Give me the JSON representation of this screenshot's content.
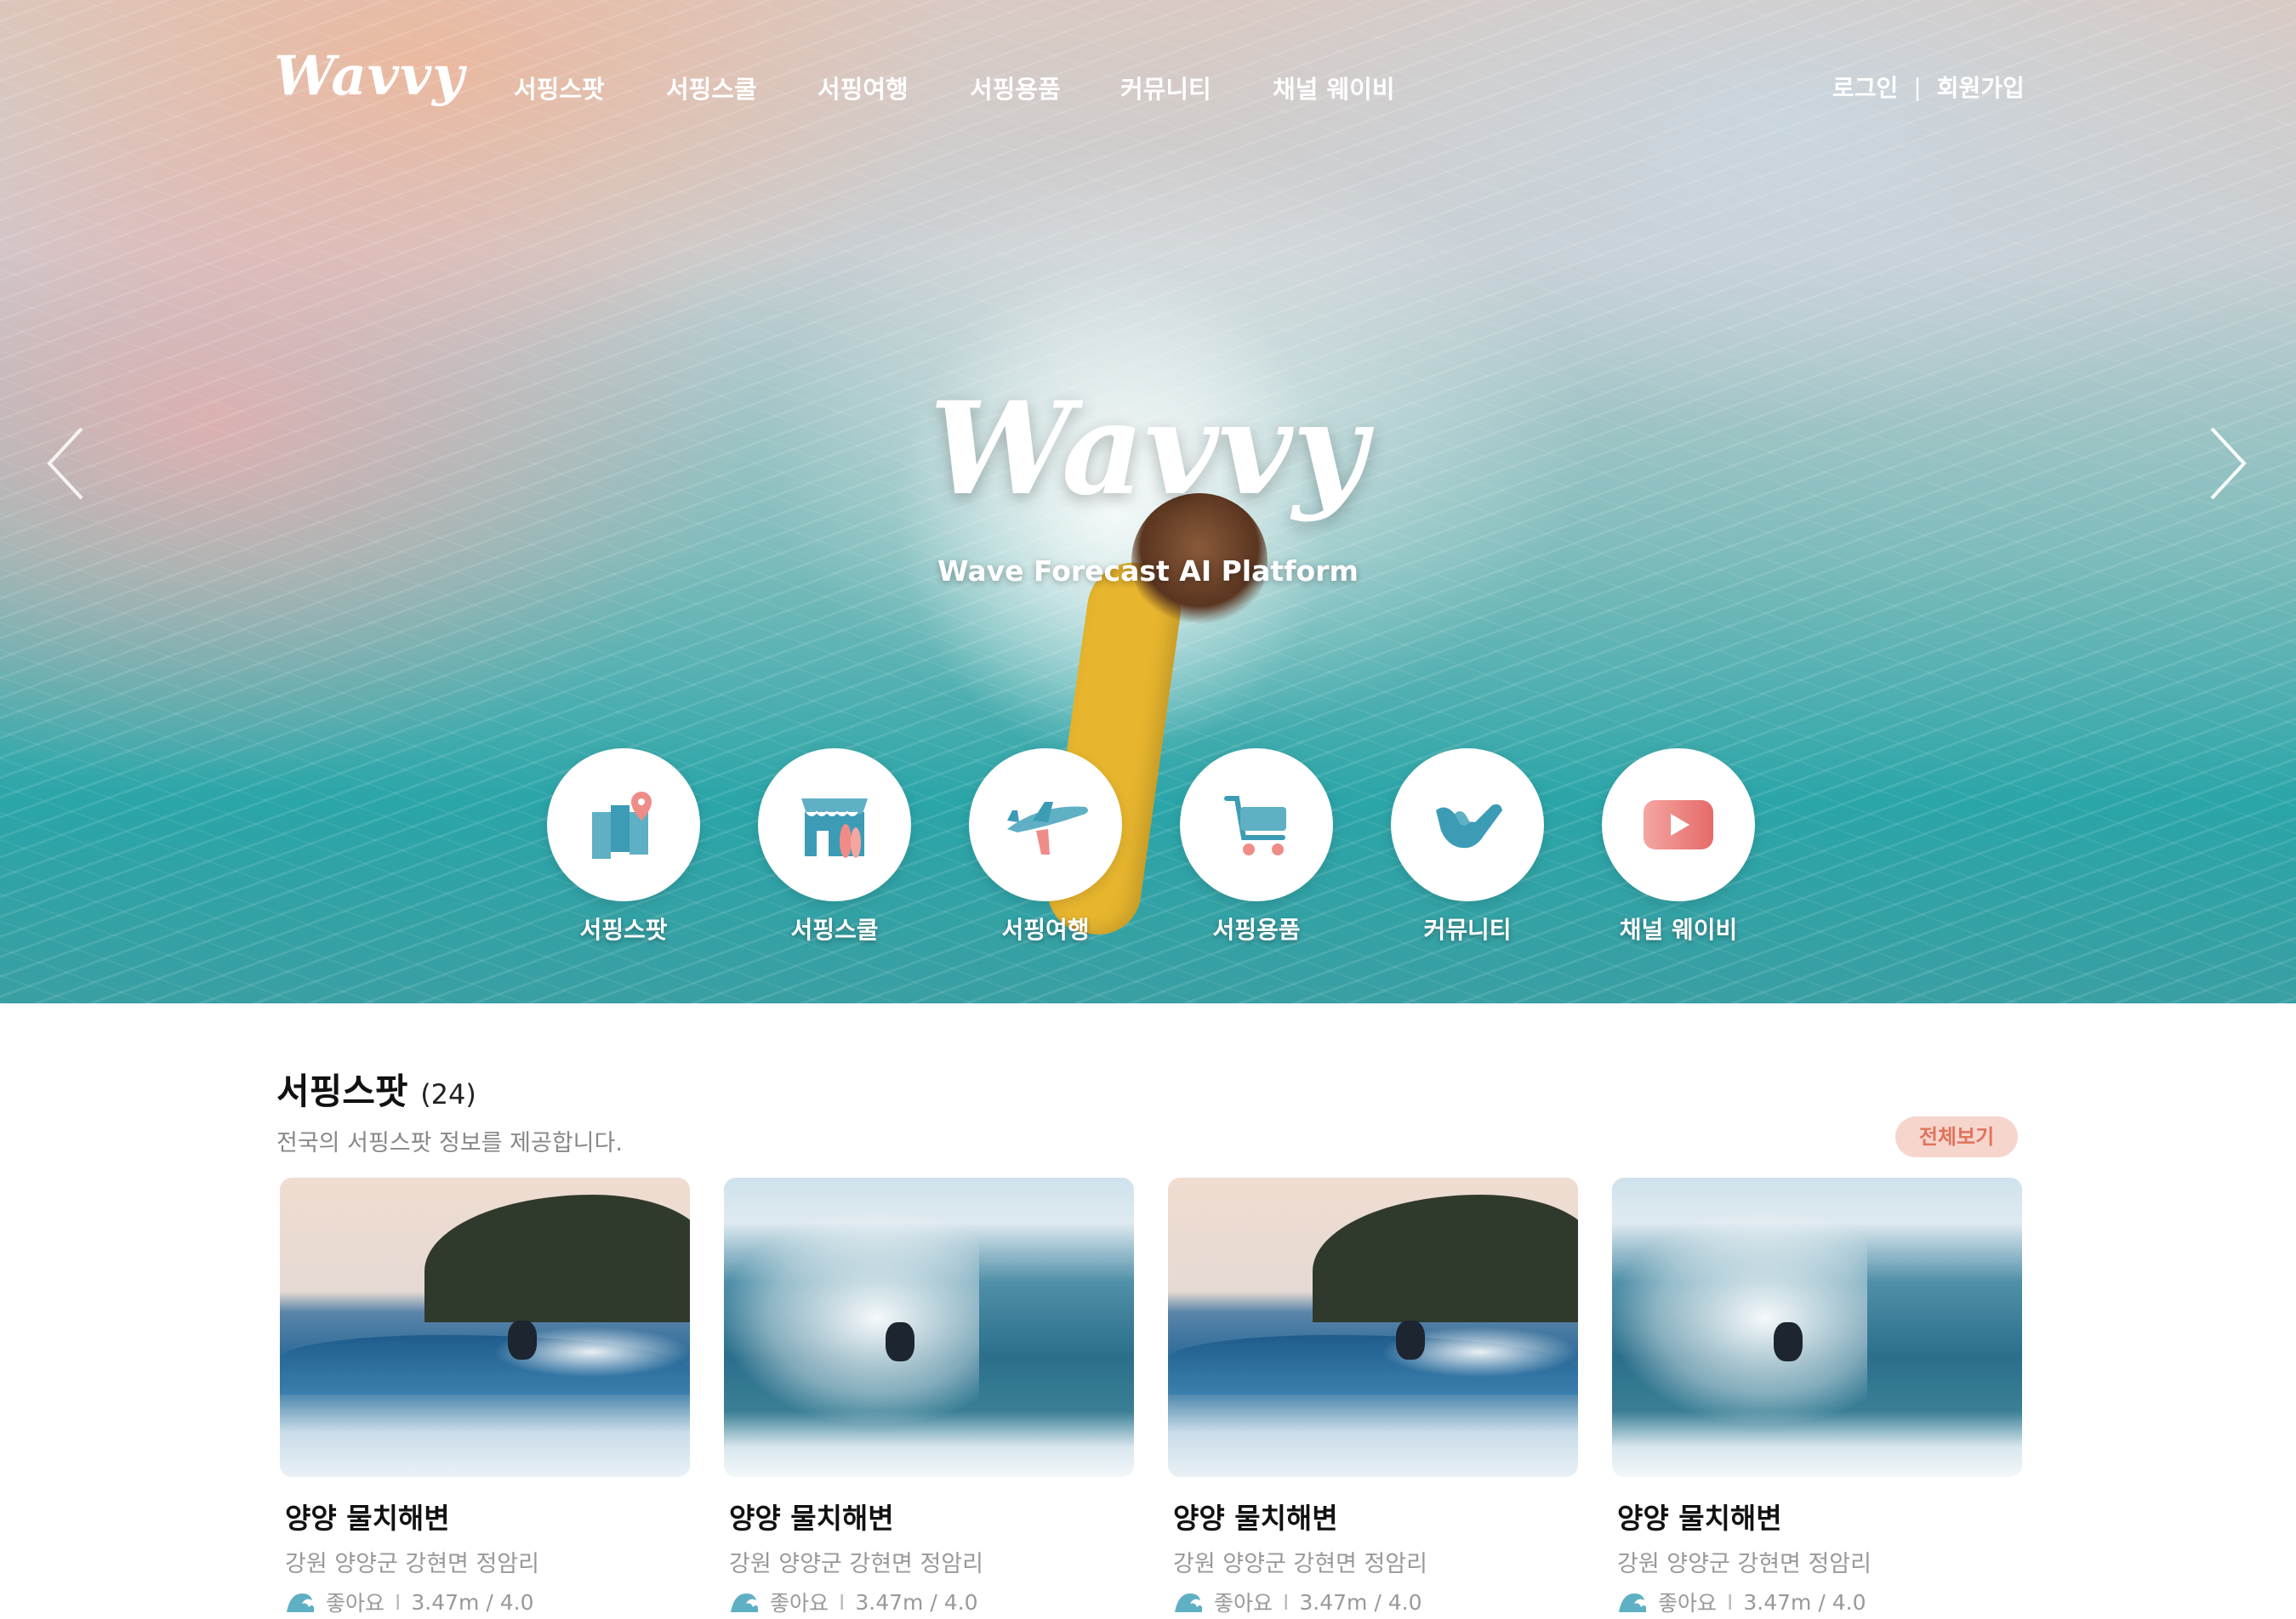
{
  "header": {
    "logo": "Wavvy",
    "nav": [
      "서핑스팟",
      "서핑스쿨",
      "서핑여행",
      "서핑용품",
      "커뮤니티",
      "채널 웨이비"
    ],
    "auth": {
      "login": "로그인",
      "separator": "|",
      "signup": "회원가입"
    }
  },
  "hero": {
    "title": "Wavvy",
    "subtitle": "Wave Forecast AI Platform",
    "quick_links": [
      {
        "label": "서핑스팟",
        "icon": "map-pin-icon"
      },
      {
        "label": "서핑스쿨",
        "icon": "shop-icon"
      },
      {
        "label": "서핑여행",
        "icon": "airplane-icon"
      },
      {
        "label": "서핑용품",
        "icon": "cart-icon"
      },
      {
        "label": "커뮤니티",
        "icon": "shaka-hand-icon"
      },
      {
        "label": "채널 웨이비",
        "icon": "play-button-icon"
      }
    ]
  },
  "spots_section": {
    "title": "서핑스팟",
    "count": "(24)",
    "description": "전국의 서핑스팟 정보를 제공합니다.",
    "view_all": "전체보기",
    "cards": [
      {
        "name": "양양 물치해변",
        "address": "강원 양양군 강현면 정암리",
        "status": "좋아요",
        "separator": "I",
        "wave": "3.47m / 4.0"
      },
      {
        "name": "양양 물치해변",
        "address": "강원 양양군 강현면 정암리",
        "status": "좋아요",
        "separator": "I",
        "wave": "3.47m / 4.0"
      },
      {
        "name": "양양 물치해변",
        "address": "강원 양양군 강현면 정암리",
        "status": "좋아요",
        "separator": "I",
        "wave": "3.47m / 4.0"
      },
      {
        "name": "양양 물치해변",
        "address": "강원 양양군 강현면 정암리",
        "status": "좋아요",
        "separator": "I",
        "wave": "3.47m / 4.0"
      }
    ]
  },
  "colors": {
    "accent": "#e0735b",
    "accent_bg": "#f6d5cd",
    "icon_teal": "#3c9bb5",
    "icon_pink": "#ef8c88"
  }
}
